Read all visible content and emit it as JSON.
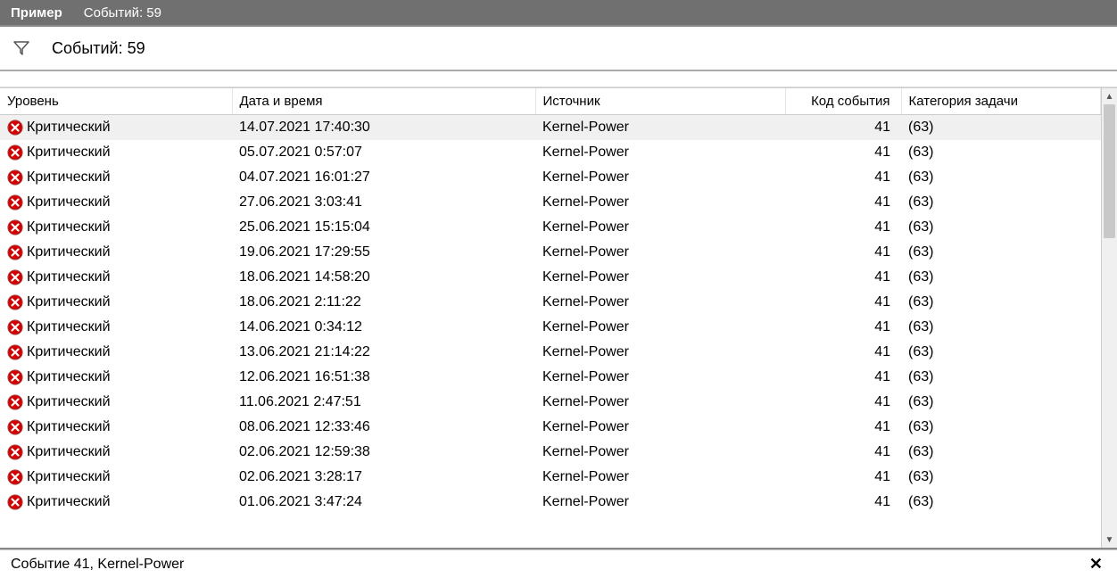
{
  "titlebar": {
    "title": "Пример",
    "subtitle": "Событий: 59"
  },
  "filterbar": {
    "text": "Событий: 59"
  },
  "table": {
    "headers": {
      "level": "Уровень",
      "datetime": "Дата и время",
      "source": "Источник",
      "code": "Код события",
      "category": "Категория задачи"
    },
    "rows": [
      {
        "level": "Критический",
        "datetime": "14.07.2021 17:40:30",
        "source": "Kernel-Power",
        "code": "41",
        "category": "(63)",
        "selected": true
      },
      {
        "level": "Критический",
        "datetime": "05.07.2021 0:57:07",
        "source": "Kernel-Power",
        "code": "41",
        "category": "(63)"
      },
      {
        "level": "Критический",
        "datetime": "04.07.2021 16:01:27",
        "source": "Kernel-Power",
        "code": "41",
        "category": "(63)"
      },
      {
        "level": "Критический",
        "datetime": "27.06.2021 3:03:41",
        "source": "Kernel-Power",
        "code": "41",
        "category": "(63)"
      },
      {
        "level": "Критический",
        "datetime": "25.06.2021 15:15:04",
        "source": "Kernel-Power",
        "code": "41",
        "category": "(63)"
      },
      {
        "level": "Критический",
        "datetime": "19.06.2021 17:29:55",
        "source": "Kernel-Power",
        "code": "41",
        "category": "(63)"
      },
      {
        "level": "Критический",
        "datetime": "18.06.2021 14:58:20",
        "source": "Kernel-Power",
        "code": "41",
        "category": "(63)"
      },
      {
        "level": "Критический",
        "datetime": "18.06.2021 2:11:22",
        "source": "Kernel-Power",
        "code": "41",
        "category": "(63)"
      },
      {
        "level": "Критический",
        "datetime": "14.06.2021 0:34:12",
        "source": "Kernel-Power",
        "code": "41",
        "category": "(63)"
      },
      {
        "level": "Критический",
        "datetime": "13.06.2021 21:14:22",
        "source": "Kernel-Power",
        "code": "41",
        "category": "(63)"
      },
      {
        "level": "Критический",
        "datetime": "12.06.2021 16:51:38",
        "source": "Kernel-Power",
        "code": "41",
        "category": "(63)"
      },
      {
        "level": "Критический",
        "datetime": "11.06.2021 2:47:51",
        "source": "Kernel-Power",
        "code": "41",
        "category": "(63)"
      },
      {
        "level": "Критический",
        "datetime": "08.06.2021 12:33:46",
        "source": "Kernel-Power",
        "code": "41",
        "category": "(63)"
      },
      {
        "level": "Критический",
        "datetime": "02.06.2021 12:59:38",
        "source": "Kernel-Power",
        "code": "41",
        "category": "(63)"
      },
      {
        "level": "Критический",
        "datetime": "02.06.2021 3:28:17",
        "source": "Kernel-Power",
        "code": "41",
        "category": "(63)"
      },
      {
        "level": "Критический",
        "datetime": "01.06.2021 3:47:24",
        "source": "Kernel-Power",
        "code": "41",
        "category": "(63)"
      }
    ]
  },
  "detail": {
    "text": "Событие 41, Kernel-Power"
  }
}
